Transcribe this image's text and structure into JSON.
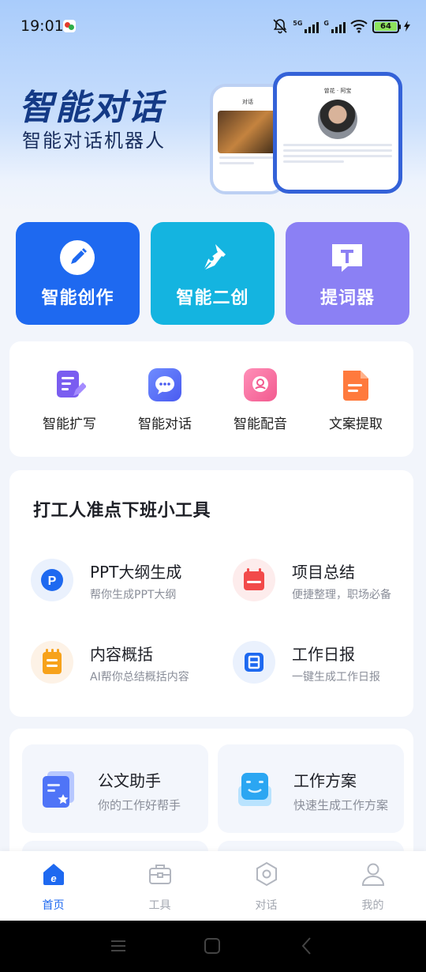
{
  "status_bar": {
    "time": "19:01",
    "net_5g": "5G",
    "net_g": "G",
    "battery": "64"
  },
  "hero": {
    "title": "智能对话",
    "subtitle": "智能对话机器人",
    "mock_back_title": "对话",
    "mock_front_title": "曾花 · 阿宝"
  },
  "big_cards": [
    {
      "label": "智能创作",
      "icon": "pencil-icon",
      "color": "#1e69f0"
    },
    {
      "label": "智能二创",
      "icon": "pen-nib-icon",
      "color": "#14b4e0"
    },
    {
      "label": "提词器",
      "icon": "teleprompter-icon",
      "color": "#8b80f4"
    }
  ],
  "quick_actions": [
    {
      "label": "智能扩写",
      "icon": "document-edit-icon"
    },
    {
      "label": "智能对话",
      "icon": "chat-bubble-icon"
    },
    {
      "label": "智能配音",
      "icon": "voice-icon"
    },
    {
      "label": "文案提取",
      "icon": "document-extract-icon"
    }
  ],
  "tools_section": {
    "title": "打工人准点下班小工具",
    "items": [
      {
        "title": "PPT大纲生成",
        "desc": "帮你生成PPT大纲",
        "icon": "ppt-icon"
      },
      {
        "title": "项目总结",
        "desc": "便捷整理，职场必备",
        "icon": "calendar-icon"
      },
      {
        "title": "内容概括",
        "desc": "AI帮你总结概括内容",
        "icon": "notepad-icon"
      },
      {
        "title": "工作日报",
        "desc": "一键生成工作日报",
        "icon": "daily-report-icon"
      }
    ]
  },
  "features": [
    {
      "title": "公文助手",
      "desc": "你的工作好帮手",
      "icon": "official-doc-icon"
    },
    {
      "title": "工作方案",
      "desc": "快速生成工作方案",
      "icon": "work-plan-icon"
    }
  ],
  "tabbar": [
    {
      "label": "首页",
      "icon": "home-icon",
      "active": true
    },
    {
      "label": "工具",
      "icon": "toolbox-icon",
      "active": false
    },
    {
      "label": "对话",
      "icon": "chat-hexagon-icon",
      "active": false
    },
    {
      "label": "我的",
      "icon": "user-icon",
      "active": false
    }
  ],
  "colors": {
    "primary": "#1e69f0",
    "cyan": "#14b4e0",
    "violet": "#8b80f4",
    "hero_title": "#143a86"
  }
}
